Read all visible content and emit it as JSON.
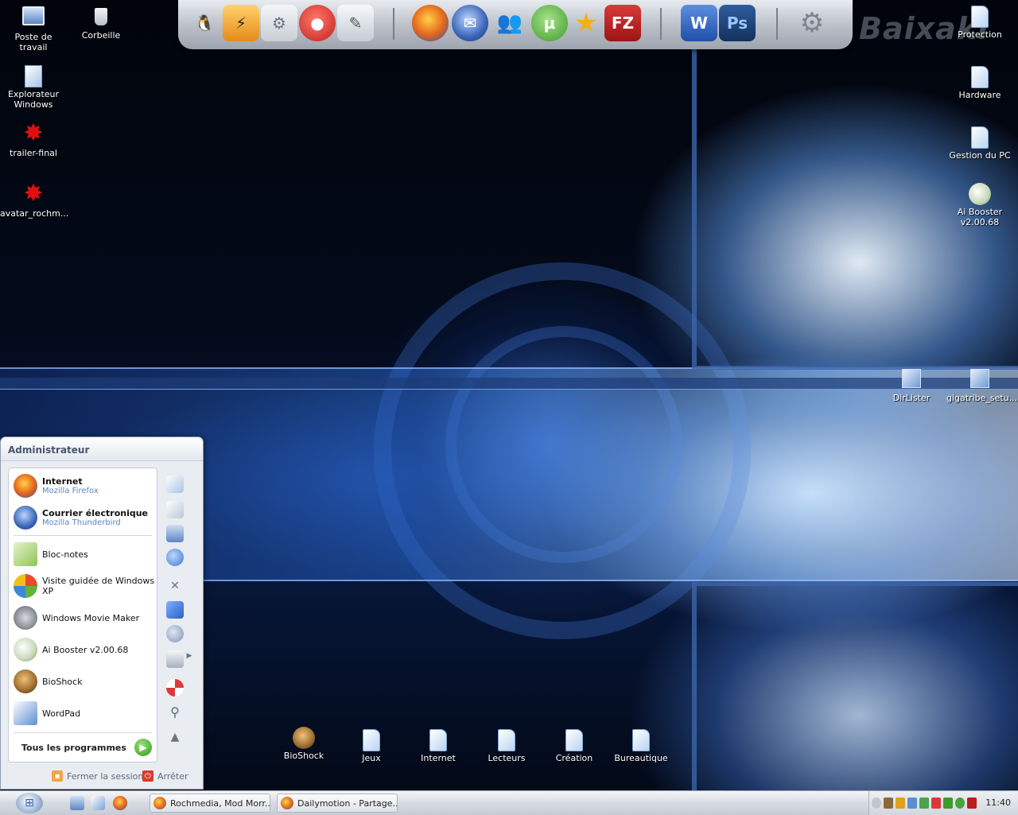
{
  "desktop": {
    "left_icons": [
      {
        "label": "Poste de travail",
        "icon": "computer-icon"
      },
      {
        "label": "Corbeille",
        "icon": "recycle-bin-icon"
      },
      {
        "label": "Explorateur Windows",
        "icon": "explorer-icon"
      },
      {
        "label": "trailer-final",
        "icon": "red-splat-icon"
      },
      {
        "label": "avatar_rochm...",
        "icon": "red-splat-icon"
      }
    ],
    "right_icons": [
      {
        "label": "Protection",
        "icon": "document-icon"
      },
      {
        "label": "Hardware",
        "icon": "document-icon"
      },
      {
        "label": "Gestion du PC",
        "icon": "document-icon"
      },
      {
        "label": "Ai Booster v2.00.68",
        "icon": "ai-booster-icon"
      },
      {
        "label": "DirLister",
        "icon": "installer-icon"
      },
      {
        "label": "gigatribe_setu...",
        "icon": "installer-icon"
      }
    ],
    "bottom_icons": [
      {
        "label": "BioShock",
        "icon": "bioshock-icon"
      },
      {
        "label": "Jeux",
        "icon": "document-icon"
      },
      {
        "label": "Internet",
        "icon": "document-icon"
      },
      {
        "label": "Lecteurs",
        "icon": "document-icon"
      },
      {
        "label": "Création",
        "icon": "document-icon"
      },
      {
        "label": "Bureautique",
        "icon": "document-icon"
      }
    ],
    "watermark": "Baixaki"
  },
  "dock": {
    "items": [
      {
        "name": "pidgin-icon",
        "glyph": "🐧",
        "color": "#6f8fc2"
      },
      {
        "name": "winamp-icon",
        "glyph": "⚡",
        "color": "#e58a1a"
      },
      {
        "name": "control-panel-icon",
        "glyph": "⚙",
        "color": "#c9ced6"
      },
      {
        "name": "nero-icon",
        "glyph": "🔥",
        "color": "#d0312d"
      },
      {
        "name": "notepad-icon",
        "glyph": "✎",
        "color": "#d8dde6"
      },
      {
        "name": "firefox-icon",
        "glyph": "🦊",
        "color": "#e86a1c"
      },
      {
        "name": "thunderbird-icon",
        "glyph": "✉",
        "color": "#3b64b8"
      },
      {
        "name": "msn-messenger-icon",
        "glyph": "👥",
        "color": "#4aa34a"
      },
      {
        "name": "utorrent-icon",
        "glyph": "µ",
        "color": "#49a23a"
      },
      {
        "name": "star-icon",
        "glyph": "★",
        "color": "#f2b01c"
      },
      {
        "name": "filezilla-icon",
        "glyph": "FZ",
        "color": "#b91d1d"
      },
      {
        "name": "word-icon",
        "glyph": "W",
        "color": "#2c5fb8"
      },
      {
        "name": "photoshop-icon",
        "glyph": "Ps",
        "color": "#1c3d6e"
      },
      {
        "name": "settings-gears-icon",
        "glyph": "⚙",
        "color": "#9aa0aa"
      }
    ]
  },
  "start_menu": {
    "user": "Administrateur",
    "pinned": [
      {
        "title": "Internet",
        "subtitle": "Mozilla Firefox",
        "color": "#e86a1c"
      },
      {
        "title": "Courrier électronique",
        "subtitle": "Mozilla Thunderbird",
        "color": "#3b64b8"
      }
    ],
    "recent": [
      {
        "title": "Bloc-notes",
        "color": "#8fc35a"
      },
      {
        "title": "Visite guidée de Windows XP",
        "color": "#3c87d8"
      },
      {
        "title": "Windows Movie Maker",
        "color": "#8e9298"
      },
      {
        "title": "Ai Booster v2.00.68",
        "color": "#b0c7a5"
      },
      {
        "title": "BioShock",
        "color": "#9b6b2e"
      },
      {
        "title": "WordPad",
        "color": "#5b8fd0"
      }
    ],
    "all_programs": "Tous les programmes",
    "logoff": "Fermer la session",
    "shutdown": "Arrêter"
  },
  "taskbar": {
    "tasks": [
      {
        "label": "Rochmedia, Mod Morr..."
      },
      {
        "label": "Dailymotion - Partage..."
      }
    ],
    "clock": "11:40"
  }
}
